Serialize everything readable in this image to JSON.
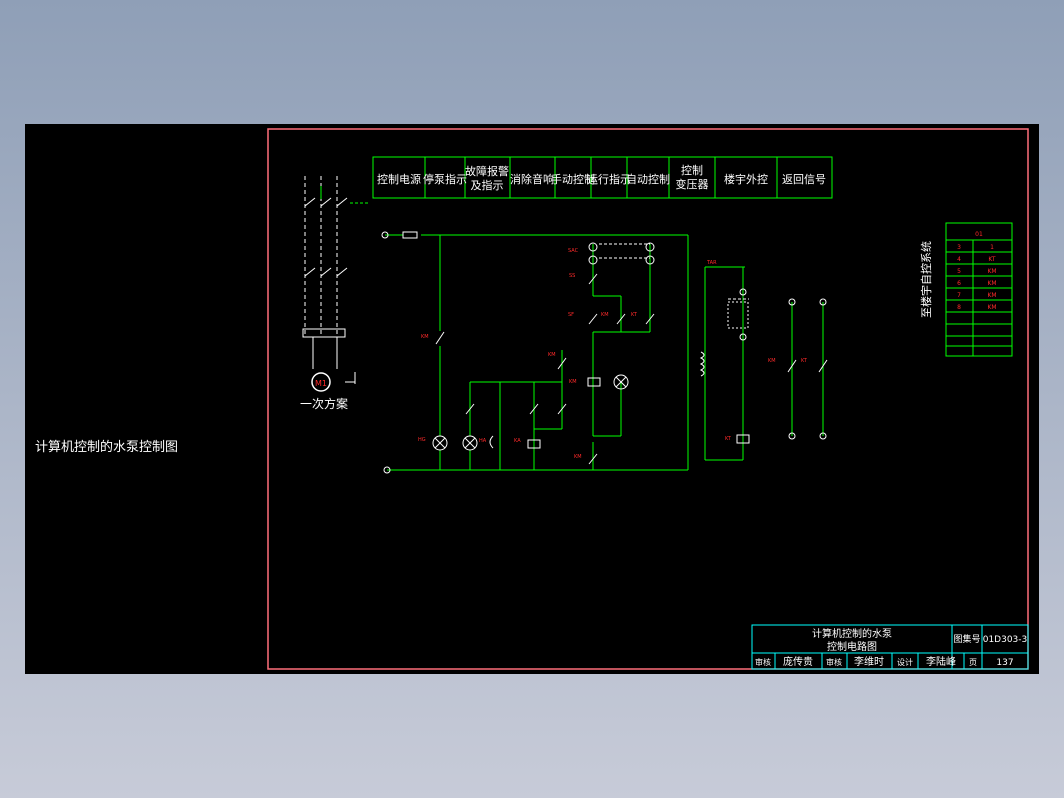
{
  "side_title": "计算机控制的水泵控制图",
  "header_cells": [
    "控制电源",
    "停泵指示",
    "故障报警",
    "及指示",
    "消除音响",
    "手动控制",
    "运行指示",
    "自动控制",
    "控制",
    "变压器",
    "楼宇外控",
    "返回信号"
  ],
  "primary_label": "一次方案",
  "motor_label": "M1",
  "right_table": {
    "vertical_caption": "至楼宇自控系统",
    "header": "01",
    "rows": [
      [
        "3",
        "1"
      ],
      [
        "4",
        "KT"
      ],
      [
        "5",
        "KM"
      ],
      [
        "6",
        "KM"
      ],
      [
        "7",
        "KM"
      ],
      [
        "8",
        "KM"
      ]
    ]
  },
  "title_block": {
    "title_line1": "计算机控制的水泵",
    "title_line2": "控制电路图",
    "drawing_no_label": "图集号",
    "drawing_no": "01D303-3",
    "review_label": "审核",
    "reviewer": "庞传贵",
    "check_label": "审核",
    "checker": "李维时",
    "design_label": "设计",
    "designer": "李陆峰",
    "page_label": "页",
    "page": "137"
  },
  "colors": {
    "background": "#000000",
    "frame": "#ff6f7a",
    "wire": "#00ff00",
    "label": "#ff2a2a",
    "text": "#ffffff",
    "table_cyan": "#00ffff"
  }
}
